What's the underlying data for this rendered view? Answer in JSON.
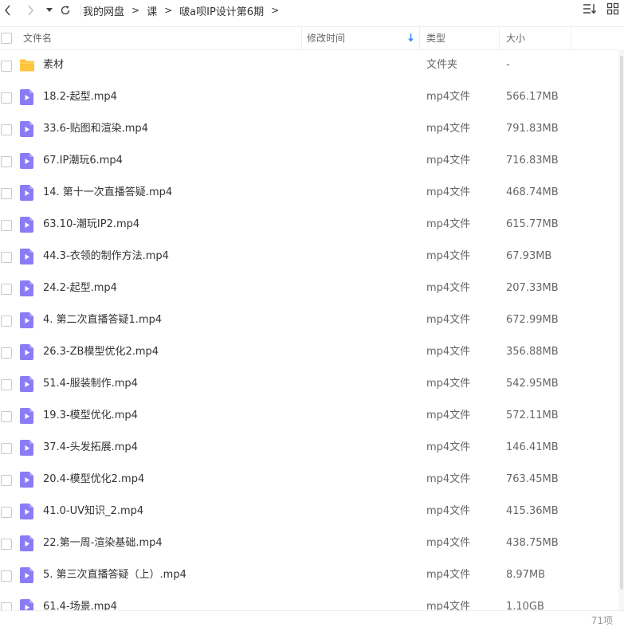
{
  "toolbar": {
    "back_icon": "chevron-left-icon",
    "forward_icon": "chevron-right-icon",
    "history_icon": "caret-down-icon",
    "refresh_icon": "refresh-icon",
    "sort_icon": "sort-icon",
    "grid_view_icon": "grid-view-icon"
  },
  "breadcrumb": {
    "items": [
      "我的网盘",
      "课",
      "啵a呗IP设计第6期"
    ],
    "separator": ">"
  },
  "table": {
    "headers": {
      "name": "文件名",
      "modified": "修改时间",
      "type": "类型",
      "size": "大小"
    },
    "sort_column": "modified",
    "sort_direction": "descending",
    "accent_color": "#3b8cff"
  },
  "files": [
    {
      "name": "素材",
      "type": "文件夹",
      "size": "-",
      "icon": "folder-icon"
    },
    {
      "name": "18.2-起型.mp4",
      "type": "mp4文件",
      "size": "566.17MB",
      "icon": "video-file-icon"
    },
    {
      "name": "33.6-贴图和渲染.mp4",
      "type": "mp4文件",
      "size": "791.83MB",
      "icon": "video-file-icon"
    },
    {
      "name": "67.IP潮玩6.mp4",
      "type": "mp4文件",
      "size": "716.83MB",
      "icon": "video-file-icon"
    },
    {
      "name": "14. 第十一次直播答疑.mp4",
      "type": "mp4文件",
      "size": "468.74MB",
      "icon": "video-file-icon"
    },
    {
      "name": "63.10-潮玩IP2.mp4",
      "type": "mp4文件",
      "size": "615.77MB",
      "icon": "video-file-icon"
    },
    {
      "name": "44.3-衣领的制作方法.mp4",
      "type": "mp4文件",
      "size": "67.93MB",
      "icon": "video-file-icon"
    },
    {
      "name": "24.2-起型.mp4",
      "type": "mp4文件",
      "size": "207.33MB",
      "icon": "video-file-icon"
    },
    {
      "name": "4. 第二次直播答疑1.mp4",
      "type": "mp4文件",
      "size": "672.99MB",
      "icon": "video-file-icon"
    },
    {
      "name": "26.3-ZB模型优化2.mp4",
      "type": "mp4文件",
      "size": "356.88MB",
      "icon": "video-file-icon"
    },
    {
      "name": "51.4-服装制作.mp4",
      "type": "mp4文件",
      "size": "542.95MB",
      "icon": "video-file-icon"
    },
    {
      "name": "19.3-模型优化.mp4",
      "type": "mp4文件",
      "size": "572.11MB",
      "icon": "video-file-icon"
    },
    {
      "name": "37.4-头发拓展.mp4",
      "type": "mp4文件",
      "size": "146.41MB",
      "icon": "video-file-icon"
    },
    {
      "name": "20.4-模型优化2.mp4",
      "type": "mp4文件",
      "size": "763.45MB",
      "icon": "video-file-icon"
    },
    {
      "name": "41.0-UV知识_2.mp4",
      "type": "mp4文件",
      "size": "415.36MB",
      "icon": "video-file-icon"
    },
    {
      "name": "22.第一周-渲染基础.mp4",
      "type": "mp4文件",
      "size": "438.75MB",
      "icon": "video-file-icon"
    },
    {
      "name": "5. 第三次直播答疑（上）.mp4",
      "type": "mp4文件",
      "size": "8.97MB",
      "icon": "video-file-icon"
    },
    {
      "name": "61.4-场景.mp4",
      "type": "mp4文件",
      "size": "1.10GB",
      "icon": "video-file-icon"
    }
  ],
  "footer": {
    "count": "71项"
  },
  "colors": {
    "folder": "#ffc53d",
    "video_icon": "#8b7cf6"
  }
}
